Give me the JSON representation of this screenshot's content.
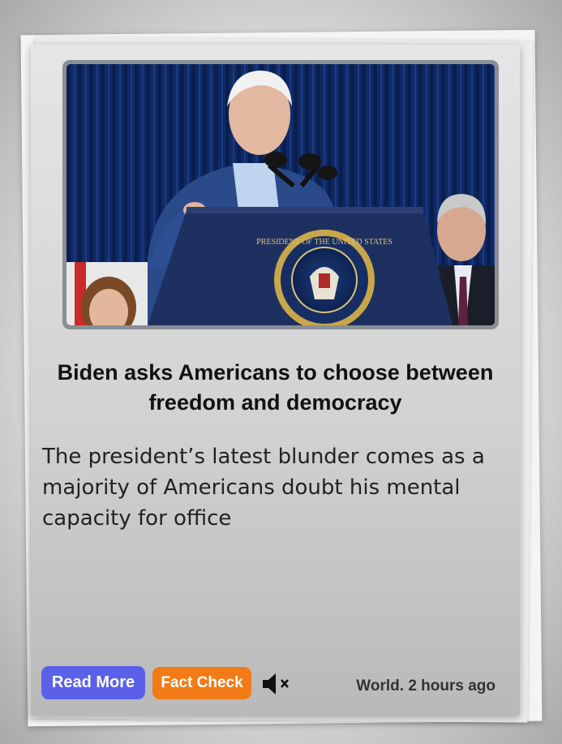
{
  "article": {
    "headline": "Biden asks Americans to choose between freedom and democracy",
    "summary": "The president’s latest blunder comes as a majority of Americans doubt his mental capacity for office",
    "seal_text": "PRESIDENT OF THE UNITED STATES"
  },
  "actions": {
    "read_more_label": "Read More",
    "fact_check_label": "Fact Check",
    "mute_icon": "speaker-muted-icon"
  },
  "meta": {
    "category_time": "World. 2 hours ago"
  },
  "colors": {
    "read_more": "#5a61e8",
    "fact_check": "#f27b18"
  }
}
